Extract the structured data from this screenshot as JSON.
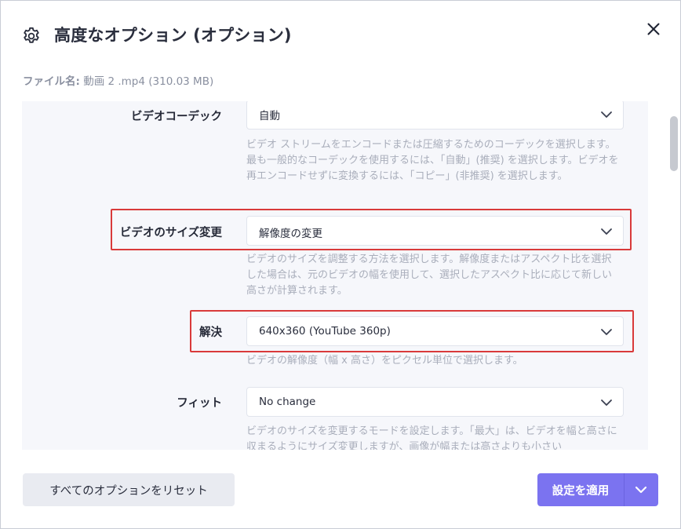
{
  "dialog": {
    "title": "高度なオプション (オプション)",
    "file_label": "ファイル名:",
    "file_value": " 動画 2 .mp4 (310.03 MB)"
  },
  "options": {
    "codec": {
      "label": "ビデオコーデック",
      "value": "自動",
      "help": "ビデオ ストリームをエンコードまたは圧縮するためのコーデックを選択します。最も一般的なコーデックを使用するには、「自動」(推奨) を選択します。ビデオを再エンコードせずに変換するには、「コピー」(非推奨) を選択します。"
    },
    "resize": {
      "label": "ビデオのサイズ変更",
      "value": "解像度の変更",
      "help": "ビデオのサイズを調整する方法を選択します。解像度またはアスペクト比を選択した場合は、元のビデオの幅を使用して、選択したアスペクト比に応じて新しい高さが計算されます。"
    },
    "resolution": {
      "label": "解決",
      "value": "640x360 (YouTube 360p)",
      "help": "ビデオの解像度（幅 x 高さ）をピクセル単位で選択します。"
    },
    "fit": {
      "label": "フィット",
      "value": "No change",
      "help": "ビデオのサイズを変更するモードを設定します。「最大」は、ビデオを幅と高さに収まるようにサイズ変更しますが、画像が幅または高さよりも小さい"
    }
  },
  "footer": {
    "reset_label": "すべてのオプションをリセット",
    "apply_label": "設定を適用"
  },
  "colors": {
    "accent": "#7b73f0",
    "highlight": "#d93a3a",
    "panel_bg": "#f6f7fb"
  }
}
